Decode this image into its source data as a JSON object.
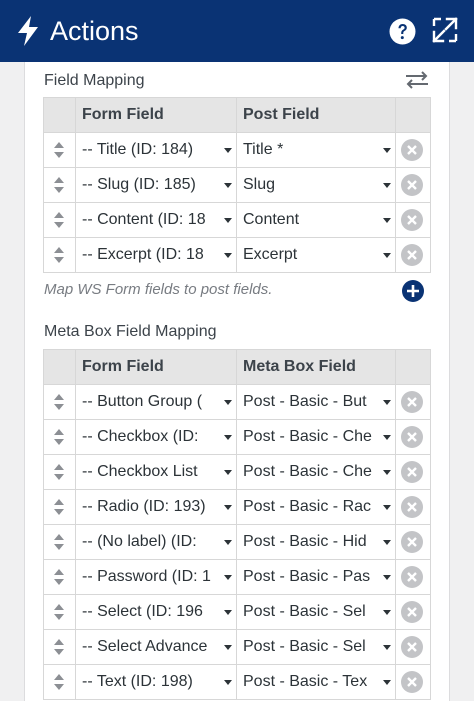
{
  "header": {
    "title": "Actions",
    "icons": [
      "bolt-icon",
      "help-icon",
      "expand-icon"
    ],
    "background": "#0a3374"
  },
  "field_mapping": {
    "label": "Field Mapping",
    "columns": [
      "Form Field",
      "Post Field"
    ],
    "rows": [
      {
        "form": "-- Title (ID: 184)",
        "post": "Title *"
      },
      {
        "form": "-- Slug (ID: 185)",
        "post": "Slug"
      },
      {
        "form": "-- Content (ID: 18",
        "post": "Content"
      },
      {
        "form": "-- Excerpt (ID: 18",
        "post": "Excerpt"
      }
    ],
    "hint": "Map WS Form fields to post fields."
  },
  "meta_box_mapping": {
    "label": "Meta Box Field Mapping",
    "columns": [
      "Form Field",
      "Meta Box Field"
    ],
    "rows": [
      {
        "form": "-- Button Group (",
        "post": "Post - Basic - But"
      },
      {
        "form": "-- Checkbox (ID: ",
        "post": "Post - Basic - Che"
      },
      {
        "form": "-- Checkbox List",
        "post": "Post - Basic - Che"
      },
      {
        "form": "-- Radio (ID: 193)",
        "post": "Post - Basic - Rac"
      },
      {
        "form": "-- (No label) (ID: ",
        "post": "Post - Basic - Hid"
      },
      {
        "form": "-- Password (ID: 1",
        "post": "Post - Basic - Pas"
      },
      {
        "form": "-- Select (ID: 196",
        "post": "Post - Basic - Sel"
      },
      {
        "form": "-- Select Advance",
        "post": "Post - Basic - Sel"
      },
      {
        "form": "-- Text (ID: 198)",
        "post": "Post - Basic - Tex"
      }
    ]
  },
  "colors": {
    "accent": "#0a3374",
    "header_row": "#e5e5e5",
    "delete_icon": "#c3c4c7"
  }
}
